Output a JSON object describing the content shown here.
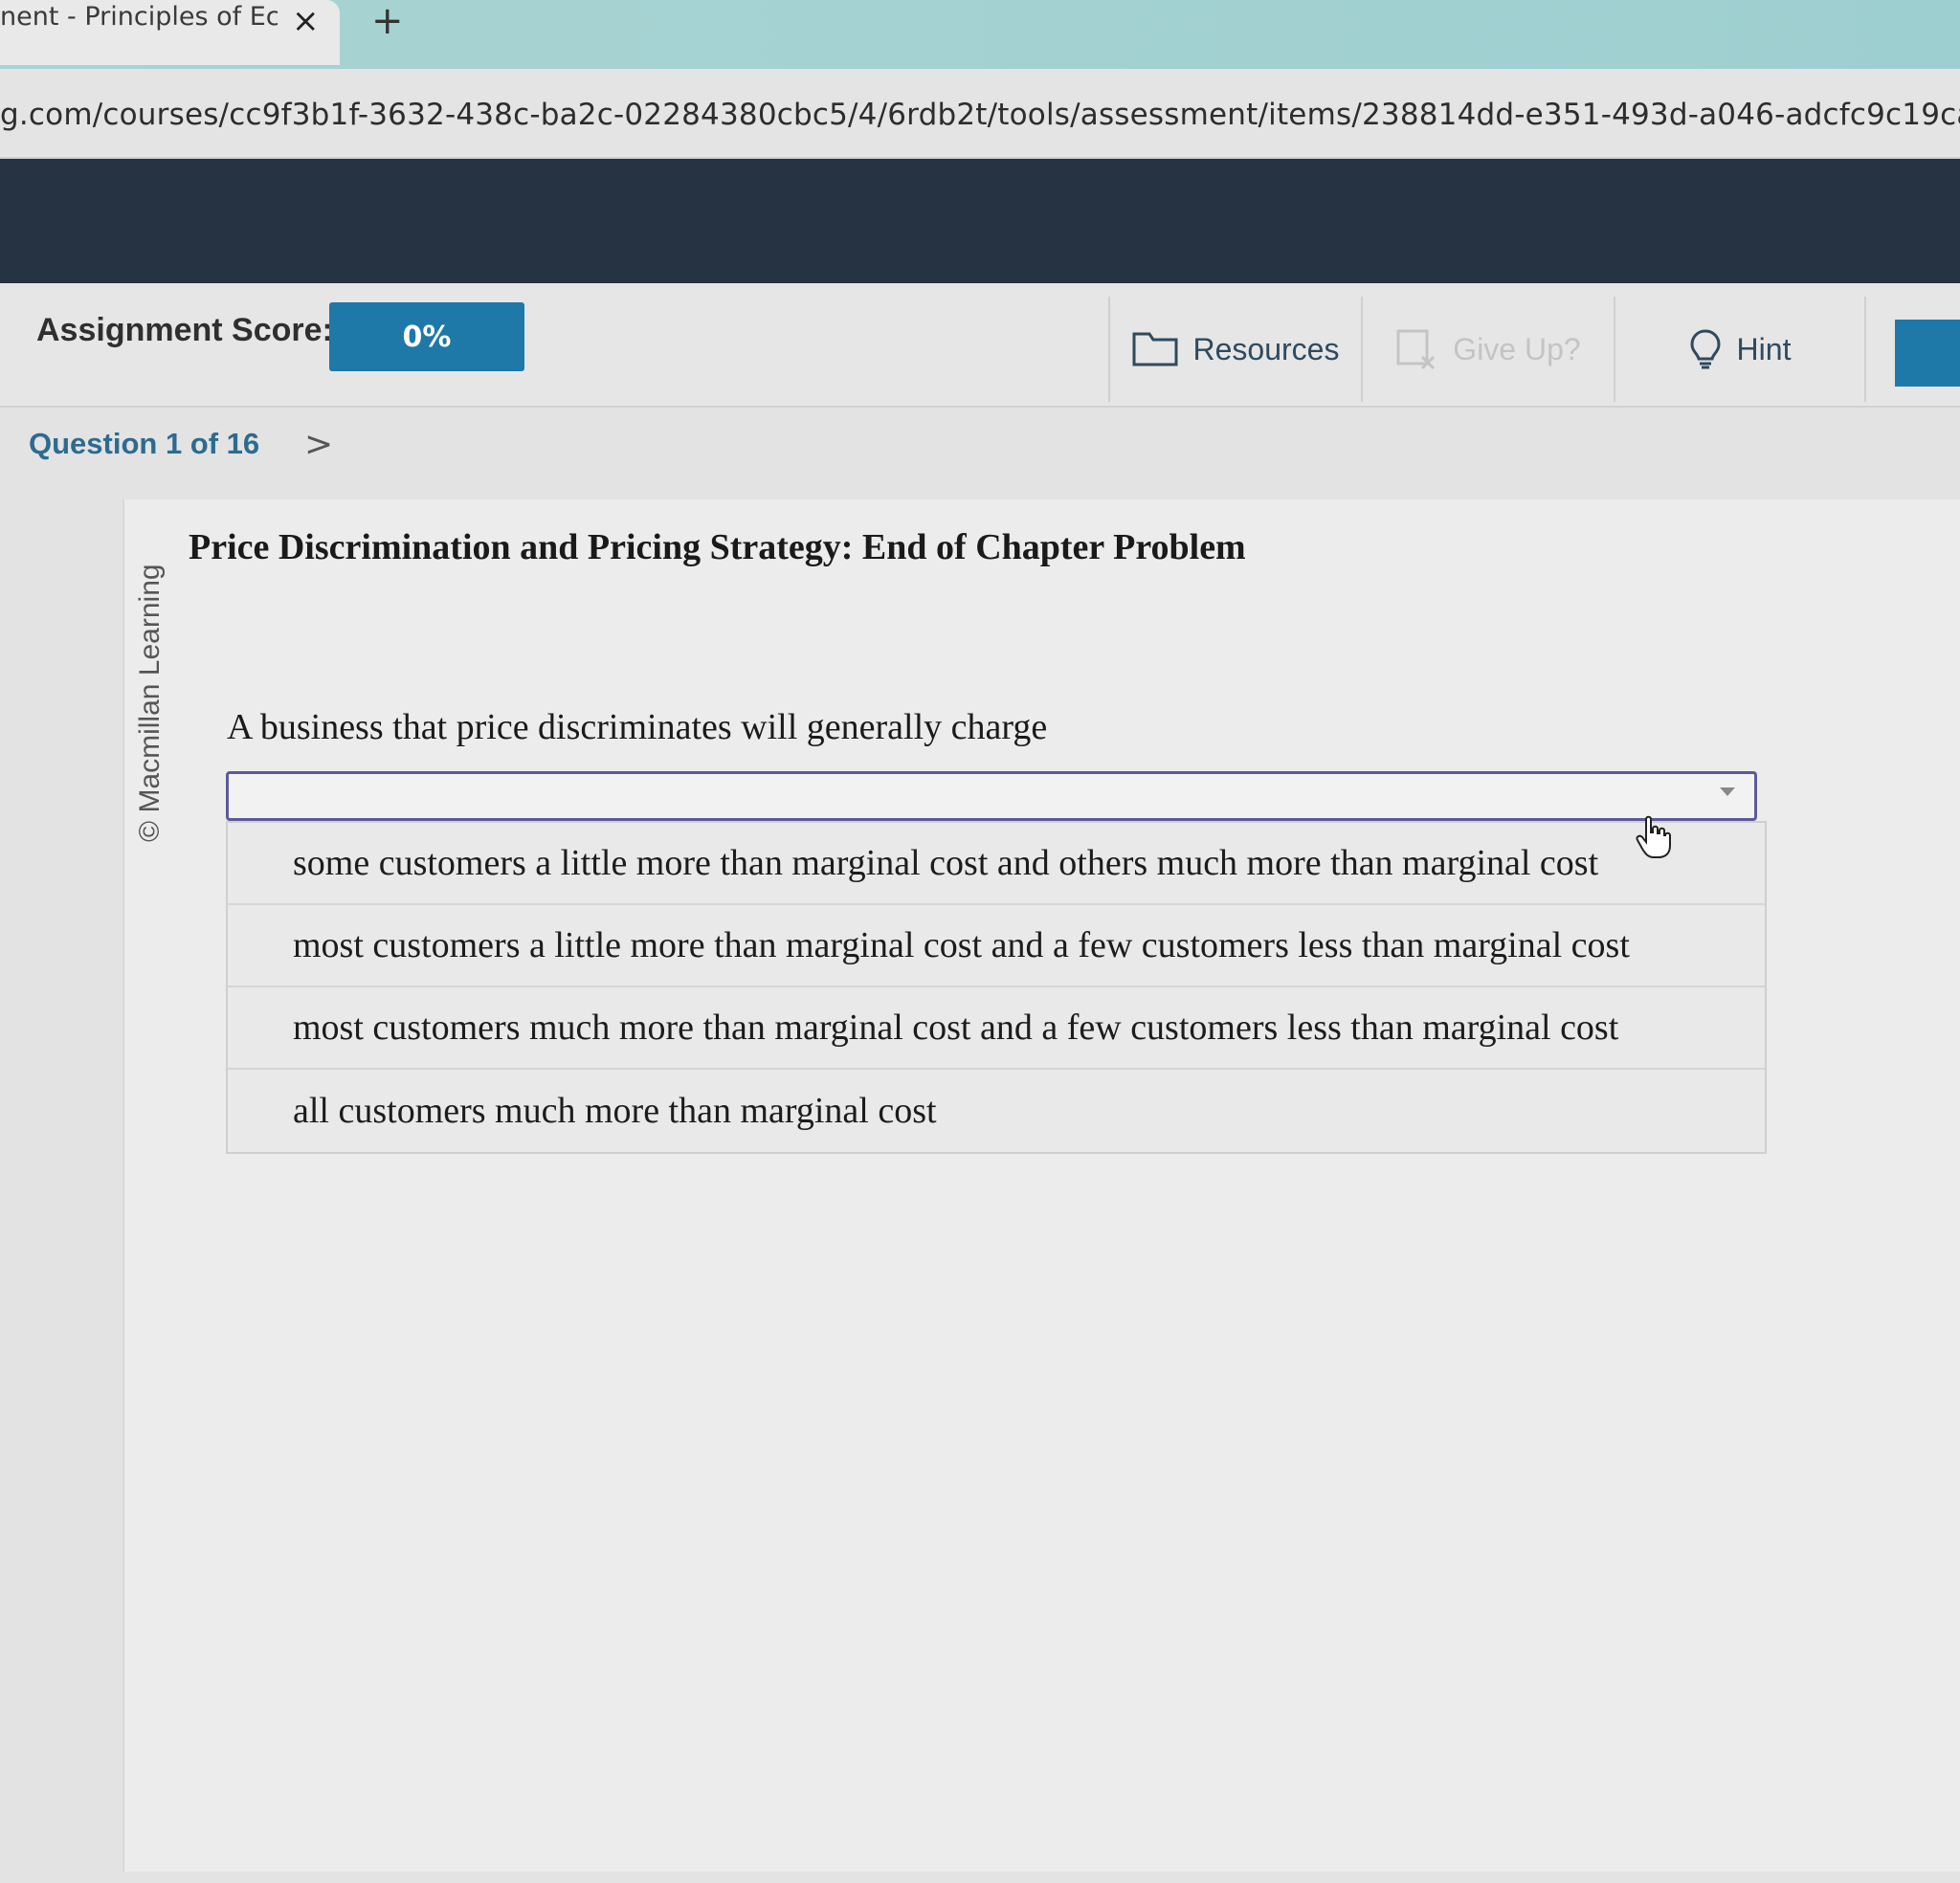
{
  "browser": {
    "tab_title": "nent - Principles of Ec",
    "tab_close": "×",
    "new_tab": "+",
    "url": "g.com/courses/cc9f3b1f-3632-438c-ba2c-02284380cbc5/4/6rdb2t/tools/assessment/items/238814dd-e351-493d-a046-adcfc9c19ca7/as"
  },
  "toolbar": {
    "score_label": "Assignment Score:",
    "score_value": "0%",
    "resources_label": "Resources",
    "giveup_label": "Give Up?",
    "hint_label": "Hint"
  },
  "nav": {
    "question_label": "Question 1 of 16",
    "next_chevron": ">"
  },
  "content": {
    "copyright": "© Macmillan Learning",
    "title": "Price Discrimination and Pricing Strategy: End of Chapter Problem",
    "prompt": "A business that price discriminates will generally charge",
    "select_value": "",
    "options": [
      "some customers a little more than marginal cost and others much more than marginal cost",
      "most customers a little more than marginal cost and a few customers less than marginal cost",
      "most customers much more than marginal cost and a few customers less than marginal cost",
      "all customers much more than marginal cost"
    ]
  },
  "colors": {
    "header": "#263342",
    "accent": "#1e78a8",
    "tabbar": "#a9d3d3"
  },
  "icons": {
    "resources": "folder-icon",
    "giveup": "give-up-icon",
    "hint": "lightbulb-icon",
    "cursor": "hand-pointer-icon"
  }
}
